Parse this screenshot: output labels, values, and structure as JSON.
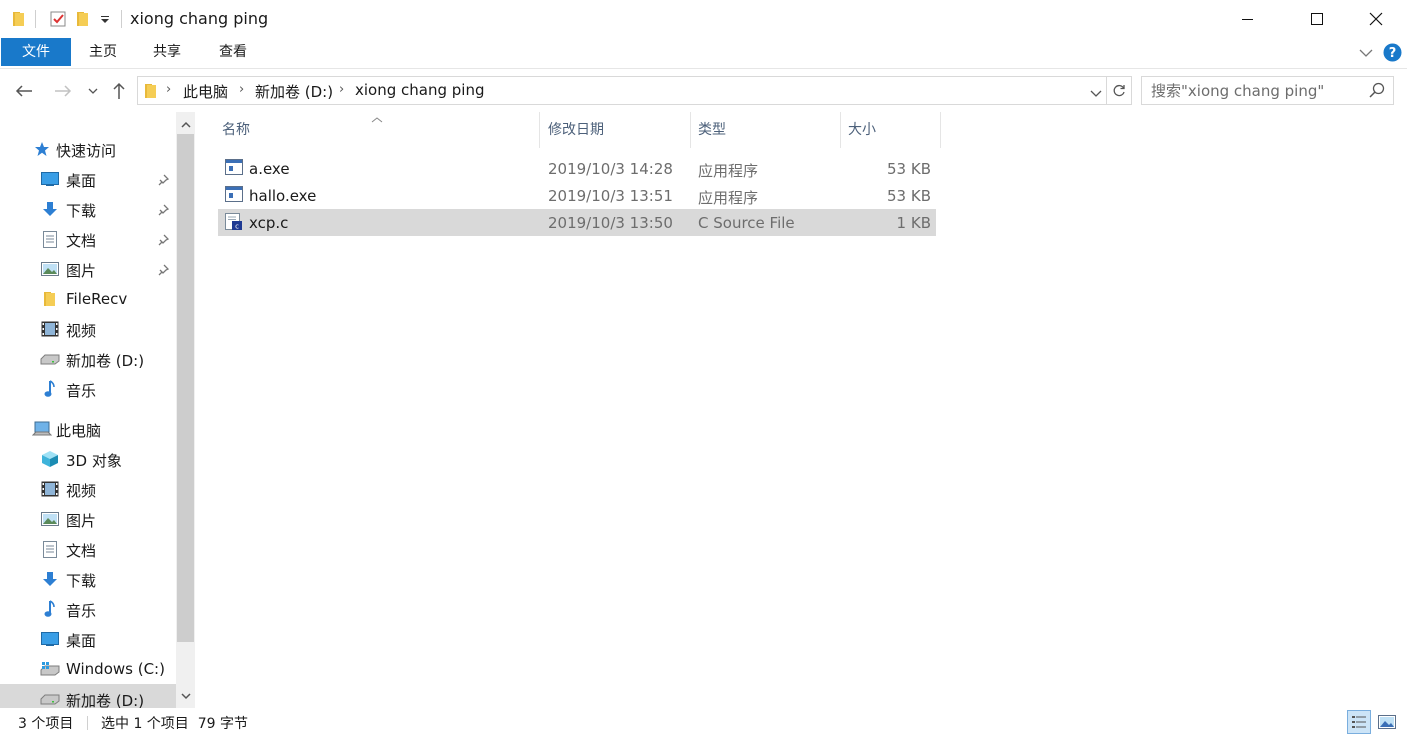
{
  "window": {
    "title": "xiong chang ping",
    "quick_access_icons": [
      "folder-icon",
      "properties-check-icon",
      "new-folder-icon",
      "customize-dropdown-icon"
    ],
    "controls": [
      "minimize-icon",
      "maximize-icon",
      "close-icon"
    ]
  },
  "ribbon": {
    "tabs": [
      {
        "label": "文件",
        "active": true
      },
      {
        "label": "主页"
      },
      {
        "label": "共享"
      },
      {
        "label": "查看"
      }
    ],
    "accent": "#1979ca",
    "help_icon": "help-icon"
  },
  "address": {
    "crumbs": [
      "此电脑",
      "新加卷 (D:)",
      "xiong chang ping"
    ]
  },
  "search": {
    "placeholder": "搜索\"xiong chang ping\""
  },
  "navpane": {
    "quick_access": {
      "label": "快速访问",
      "items": [
        {
          "label": "桌面",
          "icon": "desktop-icon",
          "pinned": true
        },
        {
          "label": "下载",
          "icon": "download-icon",
          "pinned": true
        },
        {
          "label": "文档",
          "icon": "document-icon",
          "pinned": true
        },
        {
          "label": "图片",
          "icon": "pictures-icon",
          "pinned": true
        },
        {
          "label": "FileRecv",
          "icon": "folder-icon",
          "pinned": false
        },
        {
          "label": "视频",
          "icon": "video-icon",
          "pinned": false
        },
        {
          "label": "新加卷 (D:)",
          "icon": "drive-icon",
          "pinned": false
        },
        {
          "label": "音乐",
          "icon": "music-icon",
          "pinned": false
        }
      ]
    },
    "this_pc": {
      "label": "此电脑",
      "items": [
        {
          "label": "3D 对象",
          "icon": "3d-objects-icon"
        },
        {
          "label": "视频",
          "icon": "video-icon"
        },
        {
          "label": "图片",
          "icon": "pictures-icon"
        },
        {
          "label": "文档",
          "icon": "document-icon"
        },
        {
          "label": "下载",
          "icon": "download-icon"
        },
        {
          "label": "音乐",
          "icon": "music-icon"
        },
        {
          "label": "桌面",
          "icon": "desktop-icon"
        },
        {
          "label": "Windows (C:)",
          "icon": "windows-drive-icon"
        },
        {
          "label": "新加卷 (D:)",
          "icon": "drive-icon",
          "selected": true
        }
      ]
    }
  },
  "files": {
    "columns": [
      "名称",
      "修改日期",
      "类型",
      "大小"
    ],
    "rows": [
      {
        "name": "a.exe",
        "date": "2019/10/3 14:28",
        "type": "应用程序",
        "size": "53 KB",
        "icon": "exe-icon"
      },
      {
        "name": "hallo.exe",
        "date": "2019/10/3 13:51",
        "type": "应用程序",
        "size": "53 KB",
        "icon": "exe-icon"
      },
      {
        "name": "xcp.c",
        "date": "2019/10/3 13:50",
        "type": "C Source File",
        "size": "1 KB",
        "icon": "c-source-icon",
        "selected": true
      }
    ]
  },
  "status": {
    "count": "3 个项目",
    "selection": "选中 1 个项目  79 字节"
  }
}
